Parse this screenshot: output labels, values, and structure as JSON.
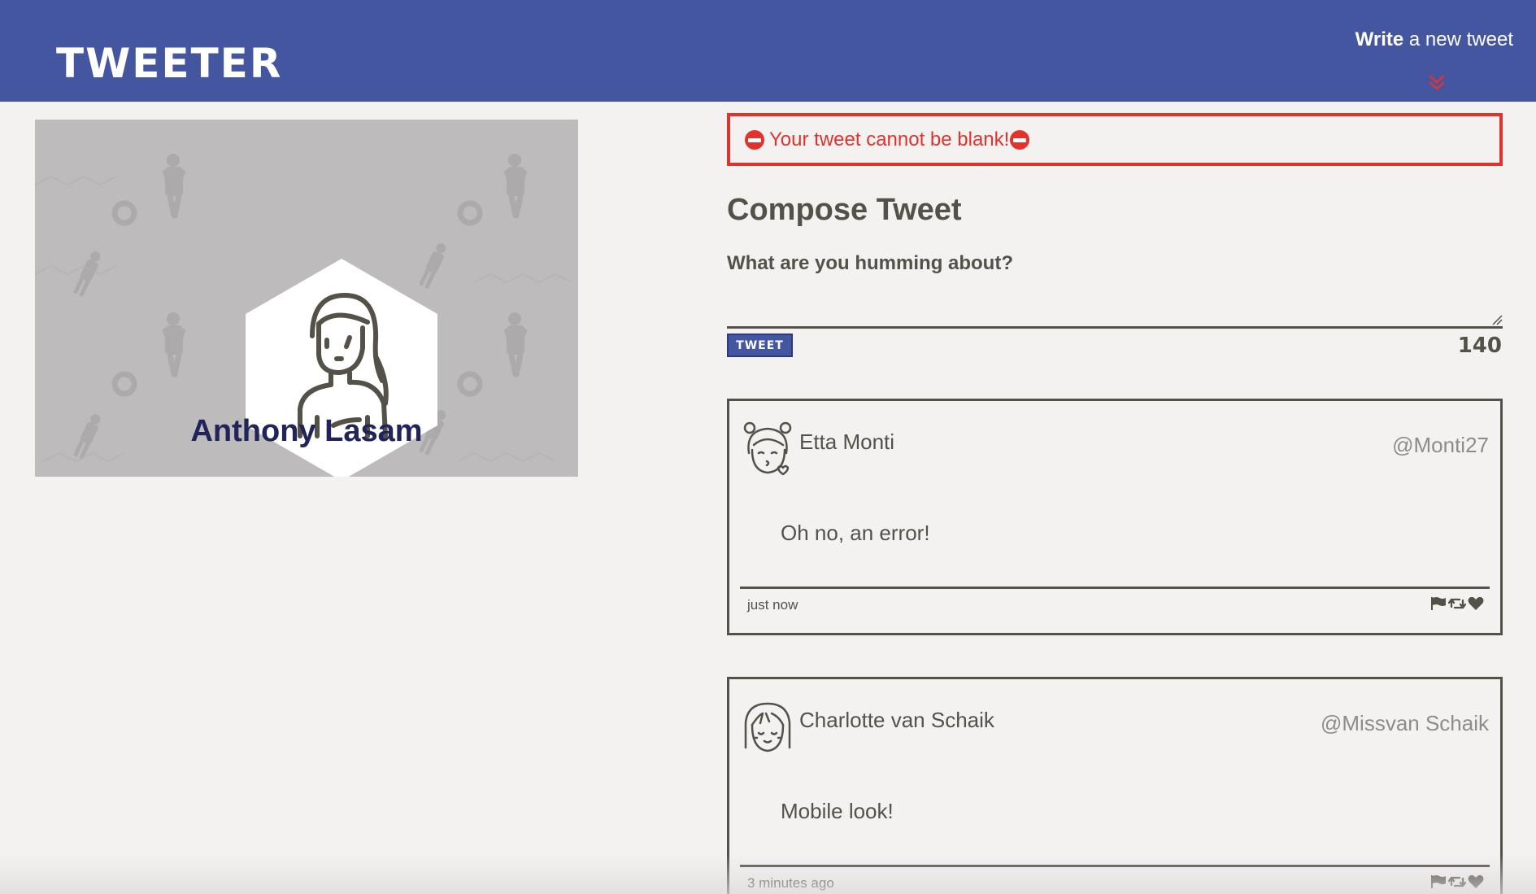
{
  "nav": {
    "logo": "TWEETER",
    "write_strong": "Write",
    "write_rest": " a new tweet",
    "arrow_icon": "double-chevron-down-icon",
    "bg_color": "#4556a0",
    "arrow_color": "#e1322c"
  },
  "profile": {
    "name": "Anthony Lasam",
    "avatar_icon": "girl-avatar-icon"
  },
  "error": {
    "text": "Your tweet cannot be blank!",
    "icon": "no-entry-icon",
    "color": "#e1322c"
  },
  "compose": {
    "title": "Compose Tweet",
    "label": "What are you humming about?",
    "textarea_value": "",
    "button_label": "TWEET",
    "counter": "140"
  },
  "tweets": [
    {
      "name": "Etta Monti",
      "handle": "@Monti27",
      "content": "Oh no, an error!",
      "time": "just now",
      "avatar_icon": "kissing-girl-avatar-icon",
      "actions": [
        "flag-icon",
        "retweet-icon",
        "heart-icon"
      ]
    },
    {
      "name": "Charlotte van Schaik",
      "handle": "@Missvan Schaik",
      "content": "Mobile look!",
      "time": "3 minutes ago",
      "avatar_icon": "smiling-girl-avatar-icon",
      "actions": [
        "flag-icon",
        "retweet-icon",
        "heart-icon"
      ]
    }
  ]
}
